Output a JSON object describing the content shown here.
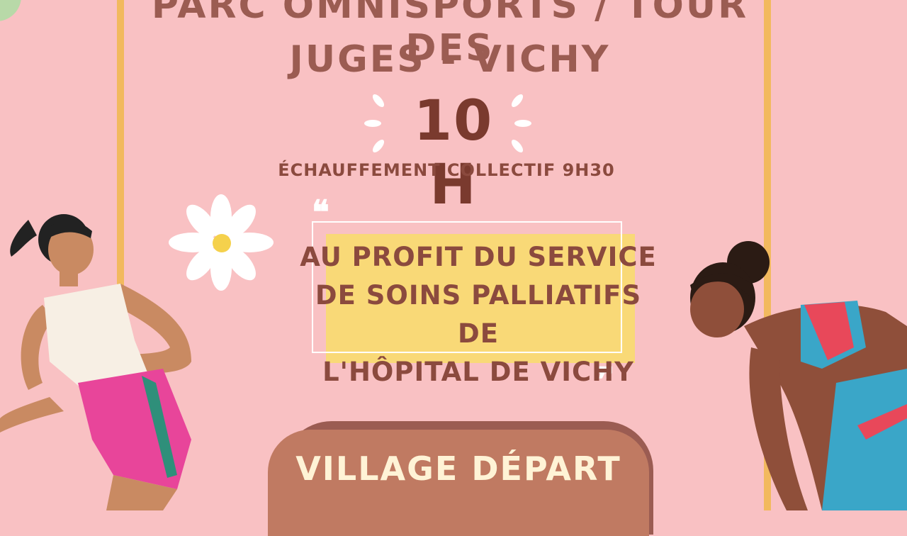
{
  "poster": {
    "title_line1": "PARC OMNISPORTS / TOUR DES",
    "title_line2": "JUGES  - VICHY",
    "time": "10 H",
    "warmup": "ÉCHAUFFEMENT COLLECTIF 9H30",
    "quote_line1": "AU PROFIT DU SERVICE",
    "quote_line2": "DE SOINS PALLIATIFS DE",
    "quote_line3": "L'HÔPITAL DE VICHY",
    "quote_open": "❝",
    "quote_close": "❞",
    "village_label": "VILLAGE DÉPART"
  },
  "colors": {
    "background": "#f9c1c3",
    "gold": "#f2b95e",
    "title": "#9b5c52",
    "highlight": "#f9d977",
    "button": "#c07a62"
  }
}
